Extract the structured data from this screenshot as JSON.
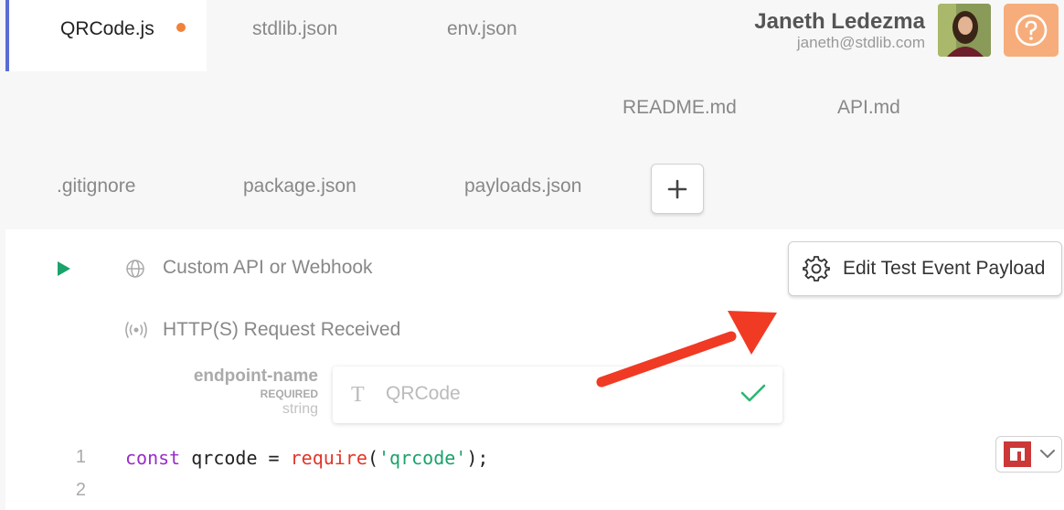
{
  "tabs": {
    "active": {
      "label": "QRCode.js",
      "modified": true
    },
    "row1": [
      "stdlib.json",
      "env.json"
    ],
    "row2": [
      "README.md",
      "API.md"
    ],
    "row3": [
      ".gitignore",
      "package.json",
      "payloads.json"
    ],
    "add_label": "+"
  },
  "user": {
    "name": "Janeth Ledezma",
    "email": "janeth@stdlib.com"
  },
  "help": {
    "icon": "question-icon"
  },
  "trigger": {
    "type_label": "Custom API or Webhook",
    "event_label": "HTTP(S) Request Received",
    "edit_payload_label": "Edit Test Event Payload"
  },
  "param": {
    "name": "endpoint-name",
    "required": "REQUIRED",
    "type": "string",
    "type_icon": "T",
    "value": "QRCode"
  },
  "code": {
    "lines": [
      {
        "n": "1",
        "parts": [
          {
            "t": "const",
            "c": "kw"
          },
          {
            "t": " qrcode = ",
            "c": ""
          },
          {
            "t": "require",
            "c": "fn"
          },
          {
            "t": "(",
            "c": ""
          },
          {
            "t": "'qrcode'",
            "c": "str"
          },
          {
            "t": ");",
            "c": ""
          }
        ]
      },
      {
        "n": "2",
        "parts": []
      }
    ]
  },
  "colors": {
    "accent": "#5b6bd6",
    "modified_dot": "#f0823a",
    "help_bg": "#f6ad7b",
    "run": "#1aa36b",
    "arrow": "#f03a24",
    "npm": "#cb3837"
  }
}
